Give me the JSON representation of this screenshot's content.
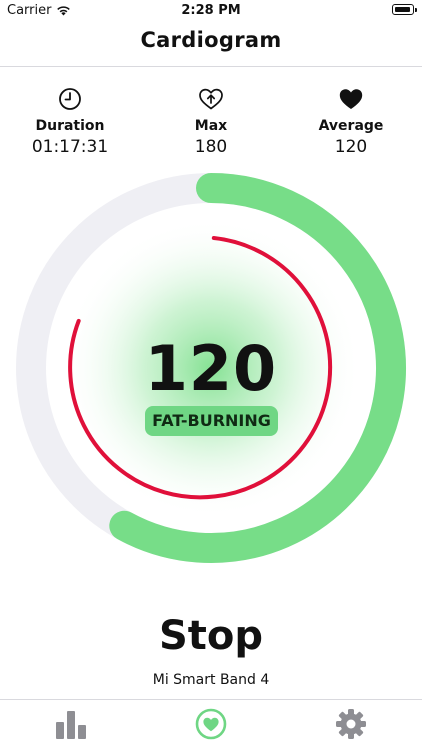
{
  "status_bar": {
    "carrier": "Carrier",
    "time": "2:28 PM"
  },
  "nav": {
    "title": "Cardiogram"
  },
  "stats": {
    "duration": {
      "label": "Duration",
      "value": "01:17:31",
      "icon": "clock-icon"
    },
    "max": {
      "label": "Max",
      "value": "180",
      "icon": "heart-up-arrow-icon"
    },
    "average": {
      "label": "Average",
      "value": "120",
      "icon": "heart-icon"
    }
  },
  "heart_rate": {
    "bpm": "120",
    "zone": "FAT-BURNING",
    "zone_progress_fraction": 0.58
  },
  "actions": {
    "stop_label": "Stop"
  },
  "device": {
    "name": "Mi Smart Band 4"
  },
  "tabs": [
    {
      "name": "stats",
      "icon": "bar-chart-icon",
      "active": false
    },
    {
      "name": "heart",
      "icon": "heart-icon",
      "active": true
    },
    {
      "name": "settings",
      "icon": "gear-icon",
      "active": false
    }
  ],
  "colors": {
    "green": "#77dd88",
    "green_badge": "#6fd684",
    "red": "#e0103a",
    "track": "#efeff4",
    "tab_inactive": "#8e8e93"
  }
}
